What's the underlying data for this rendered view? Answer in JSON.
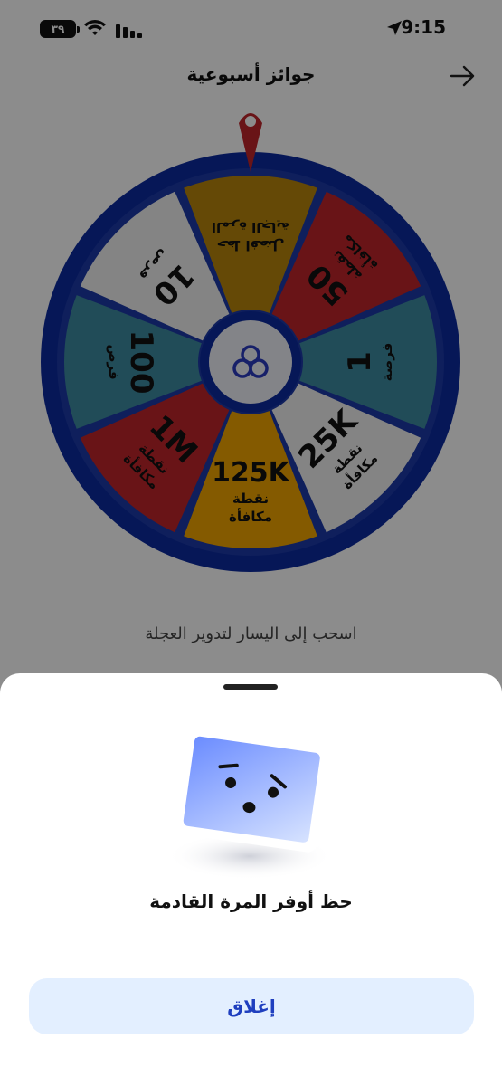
{
  "status_bar": {
    "time": "9:15",
    "battery": "٣٩"
  },
  "header": {
    "title": "جوائز أسبوعية"
  },
  "wheel": {
    "segments": [
      {
        "big": "",
        "small": "حظ افضل\nالمرة الجاية",
        "color": "#B8860B"
      },
      {
        "big": "50",
        "small": "نقطة\nمكافأة",
        "color": "#C0252B"
      },
      {
        "big": "1",
        "small": "فرصة",
        "color": "#3D8BA0"
      },
      {
        "big": "25K",
        "small": "نقطة\nمكافأة",
        "color": "#F0F0F0"
      },
      {
        "big": "125K",
        "small": "نقطة\nمكافأة",
        "color": "#F0A500"
      },
      {
        "big": "1M",
        "small": "نقطة\nمكافأة",
        "color": "#C0252B"
      },
      {
        "big": "100",
        "small": "فرص",
        "color": "#3D8BA0"
      },
      {
        "big": "10",
        "small": "فرص",
        "color": "#F0F0F0"
      }
    ]
  },
  "hint": "اسحب إلى اليسار لتدوير العجلة",
  "sheet": {
    "title": "حظ أوفر المرة القادمة",
    "close_label": "إغلاق"
  }
}
